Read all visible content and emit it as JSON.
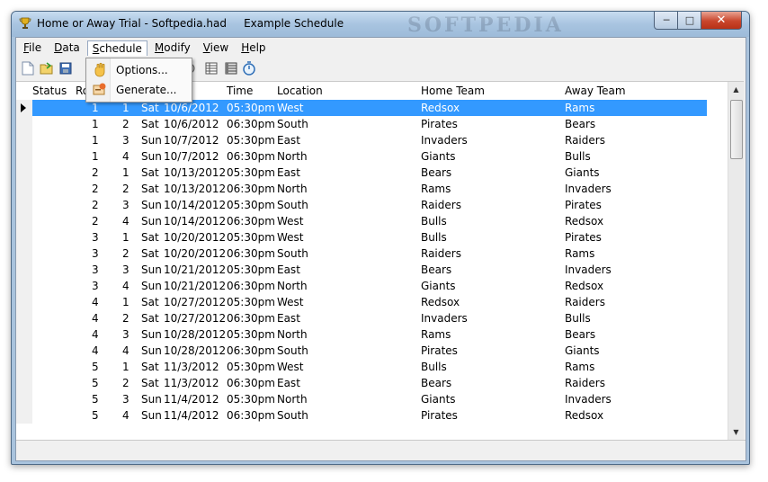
{
  "window": {
    "title": "Home or Away Trial - Softpedia.had",
    "subtitle": "Example Schedule",
    "watermark": "SOFTPEDIA"
  },
  "menu": {
    "items": [
      {
        "label": "File",
        "underline": "F",
        "rest": "ile"
      },
      {
        "label": "Data",
        "underline": "D",
        "rest": "ata"
      },
      {
        "label": "Schedule",
        "underline": "S",
        "rest": "chedule"
      },
      {
        "label": "Modify",
        "underline": "M",
        "rest": "odify"
      },
      {
        "label": "View",
        "underline": "V",
        "rest": "iew"
      },
      {
        "label": "Help",
        "underline": "H",
        "rest": "elp"
      }
    ]
  },
  "dropdown": {
    "items": [
      {
        "label": "Options...",
        "icon": "hand-icon"
      },
      {
        "label": "Generate...",
        "icon": "generate-icon"
      }
    ]
  },
  "grid": {
    "columns": [
      "Status",
      "Ro",
      "",
      "",
      "Time",
      "Location",
      "Home Team",
      "Away Team"
    ],
    "rows": [
      [
        "1",
        "1",
        "Sat",
        "10/6/2012",
        "05:30pm",
        "West",
        "Redsox",
        "Rams"
      ],
      [
        "1",
        "2",
        "Sat",
        "10/6/2012",
        "06:30pm",
        "South",
        "Pirates",
        "Bears"
      ],
      [
        "1",
        "3",
        "Sun",
        "10/7/2012",
        "05:30pm",
        "East",
        "Invaders",
        "Raiders"
      ],
      [
        "1",
        "4",
        "Sun",
        "10/7/2012",
        "06:30pm",
        "North",
        "Giants",
        "Bulls"
      ],
      [
        "2",
        "1",
        "Sat",
        "10/13/2012",
        "05:30pm",
        "East",
        "Bears",
        "Giants"
      ],
      [
        "2",
        "2",
        "Sat",
        "10/13/2012",
        "06:30pm",
        "North",
        "Rams",
        "Invaders"
      ],
      [
        "2",
        "3",
        "Sun",
        "10/14/2012",
        "05:30pm",
        "South",
        "Raiders",
        "Pirates"
      ],
      [
        "2",
        "4",
        "Sun",
        "10/14/2012",
        "06:30pm",
        "West",
        "Bulls",
        "Redsox"
      ],
      [
        "3",
        "1",
        "Sat",
        "10/20/2012",
        "05:30pm",
        "West",
        "Bulls",
        "Pirates"
      ],
      [
        "3",
        "2",
        "Sat",
        "10/20/2012",
        "06:30pm",
        "South",
        "Raiders",
        "Rams"
      ],
      [
        "3",
        "3",
        "Sun",
        "10/21/2012",
        "05:30pm",
        "East",
        "Bears",
        "Invaders"
      ],
      [
        "3",
        "4",
        "Sun",
        "10/21/2012",
        "06:30pm",
        "North",
        "Giants",
        "Redsox"
      ],
      [
        "4",
        "1",
        "Sat",
        "10/27/2012",
        "05:30pm",
        "West",
        "Redsox",
        "Raiders"
      ],
      [
        "4",
        "2",
        "Sat",
        "10/27/2012",
        "06:30pm",
        "East",
        "Invaders",
        "Bulls"
      ],
      [
        "4",
        "3",
        "Sun",
        "10/28/2012",
        "05:30pm",
        "North",
        "Rams",
        "Bears"
      ],
      [
        "4",
        "4",
        "Sun",
        "10/28/2012",
        "06:30pm",
        "South",
        "Pirates",
        "Giants"
      ],
      [
        "5",
        "1",
        "Sat",
        "11/3/2012",
        "05:30pm",
        "West",
        "Bulls",
        "Rams"
      ],
      [
        "5",
        "2",
        "Sat",
        "11/3/2012",
        "06:30pm",
        "East",
        "Bears",
        "Raiders"
      ],
      [
        "5",
        "3",
        "Sun",
        "11/4/2012",
        "05:30pm",
        "North",
        "Giants",
        "Invaders"
      ],
      [
        "5",
        "4",
        "Sun",
        "11/4/2012",
        "06:30pm",
        "South",
        "Pirates",
        "Redsox"
      ]
    ],
    "selected_row": 0
  },
  "colors": {
    "selection": "#3399ff",
    "titlebar": "#a8c4e0",
    "close_button": "#c9462c"
  }
}
